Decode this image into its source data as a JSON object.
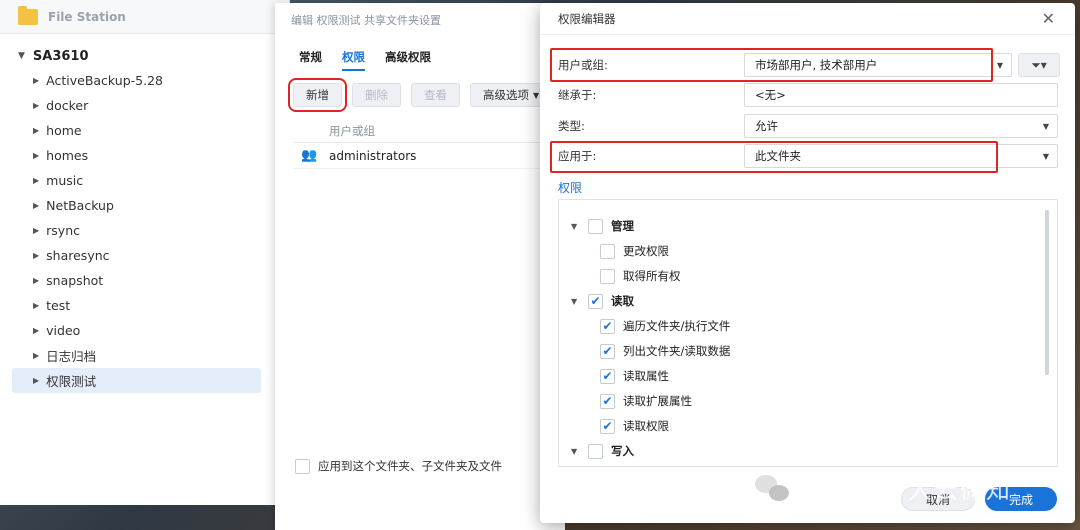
{
  "file_station": {
    "title": "File Station",
    "root": "SA3610",
    "items": [
      "ActiveBackup-5.28",
      "docker",
      "home",
      "homes",
      "music",
      "NetBackup",
      "rsync",
      "sharesync",
      "snapshot",
      "test",
      "video",
      "日志归档",
      "权限测试"
    ],
    "selected_index": 12
  },
  "edit_dialog": {
    "title": "编辑 权限测试 共享文件夹设置",
    "tabs": [
      "常规",
      "权限",
      "高级权限"
    ],
    "active_tab": 1,
    "toolbar": {
      "add": "新增",
      "delete": "删除",
      "view": "查看",
      "advanced": "高级选项"
    },
    "table_header": "用户或组",
    "rows": [
      "administrators"
    ],
    "apply_label": "应用到这个文件夹、子文件夹及文件"
  },
  "perm_editor": {
    "title": "权限编辑器",
    "user_label": "用户或组:",
    "user_value": "市场部用户, 技术部用户",
    "inherit_label": "继承于:",
    "inherit_value": "<无>",
    "type_label": "类型:",
    "type_value": "允许",
    "apply_label": "应用于:",
    "apply_value": "此文件夹",
    "section": "权限",
    "groups": [
      {
        "name": "管理",
        "checked": false,
        "items": [
          {
            "name": "更改权限",
            "checked": false
          },
          {
            "name": "取得所有权",
            "checked": false
          }
        ]
      },
      {
        "name": "读取",
        "checked": true,
        "items": [
          {
            "name": "遍历文件夹/执行文件",
            "checked": true
          },
          {
            "name": "列出文件夹/读取数据",
            "checked": true
          },
          {
            "name": "读取属性",
            "checked": true
          },
          {
            "name": "读取扩展属性",
            "checked": true
          },
          {
            "name": "读取权限",
            "checked": true
          }
        ]
      },
      {
        "name": "写入",
        "checked": false,
        "items": []
      }
    ],
    "cancel": "取消",
    "done": "完成"
  },
  "watermark": "公众号 · 大云微知",
  "colors": {
    "accent": "#1a73d9",
    "highlight": "#e02424"
  }
}
